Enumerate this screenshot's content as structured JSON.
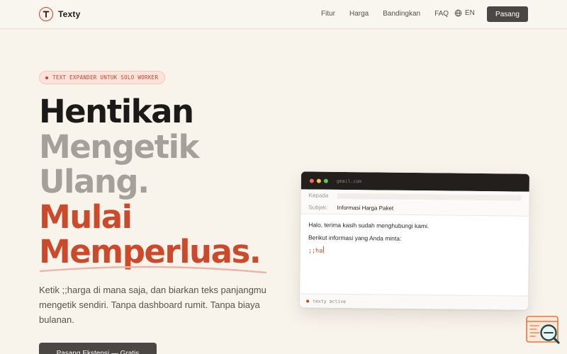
{
  "brand": {
    "name": "Texty",
    "logo_letter": "T"
  },
  "nav": {
    "links": [
      {
        "label": "Fitur"
      },
      {
        "label": "Harga"
      },
      {
        "label": "Bandingkan"
      },
      {
        "label": "FAQ"
      }
    ],
    "language": "EN",
    "install_label": "Pasang"
  },
  "hero": {
    "badge": "TEXT EXPANDER UNTUK SOLO WORKER",
    "headline": {
      "line1": "Hentikan",
      "line2": "Mengetik",
      "line3": "Ulang.",
      "line4": "Mulai",
      "line5": "Memperluas."
    },
    "subtitle": "Ketik ;;harga di mana saja, dan biarkan teks panjangmu mengetik sendiri. Tanpa dashboard rumit. Tanpa biaya bulanan.",
    "cta_label": "Pasang Ekstensi — Gratis"
  },
  "mock": {
    "url": "gmail.com",
    "to_label": "Kepada",
    "subject_label": "Subjek:",
    "subject_value": "Informasi Harga Paket",
    "body_line1": "Halo, terima kasih sudah menghubungi kami.",
    "body_line2": "Berikut informasi yang Anda minta:",
    "snippet": ";;ha",
    "status": "texty active"
  },
  "colors": {
    "background": "#f8f4ec",
    "accent": "#cb4a2b",
    "dark_button": "#4a4744",
    "muted_headline": "#a5a09a"
  },
  "icons": [
    "globe-icon",
    "help-widget-icon",
    "magnifier-icon"
  ]
}
